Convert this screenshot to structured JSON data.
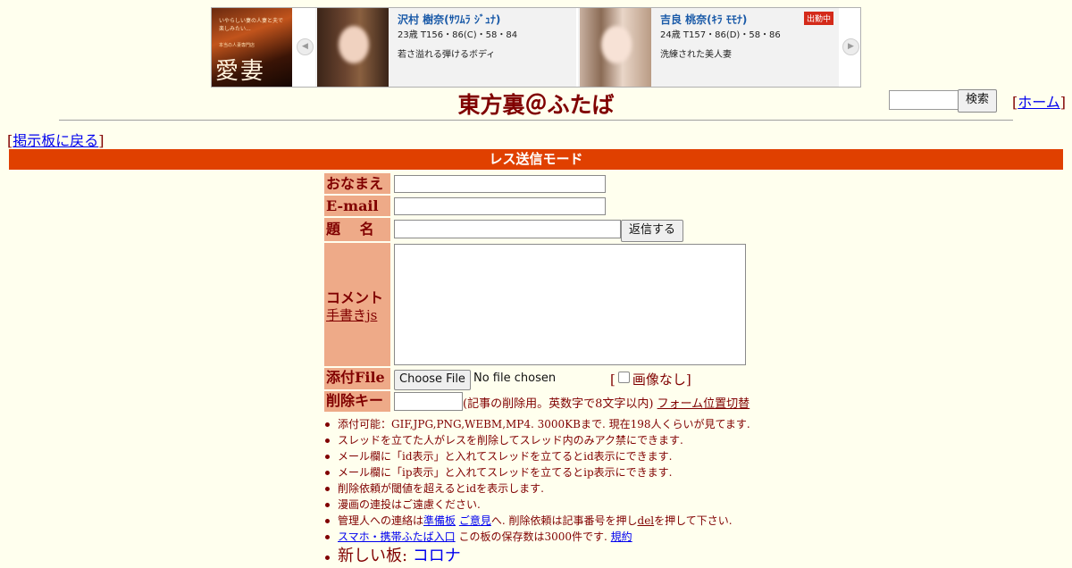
{
  "ad": {
    "logo_tagline": "いやらしい妻の人妻と夫で楽しみたい...",
    "logo_sub": "本当の人妻専門店",
    "logo_big": "愛妻",
    "prev_arrow": "◀",
    "next_arrow": "▶",
    "cards": [
      {
        "name": "沢村 樹奈(ｻﾜﾑﾗ ｼﾞｭﾅ)",
        "stats": "23歳 T156・86(C)・58・84",
        "catch": "若さ溢れる弾けるボディ",
        "badge": ""
      },
      {
        "name": "吉良 桃奈(ｷﾗ ﾓﾓﾅ)",
        "stats": "24歳 T157・86(D)・58・86",
        "catch": "洗練された美人妻",
        "badge": "出勤中"
      }
    ]
  },
  "header": {
    "title": "東方裏＠ふたば",
    "search_button": "検索",
    "home_open": "[",
    "home_link": "ホーム",
    "home_close": "]"
  },
  "nav": {
    "back_open": "[",
    "back_link": "掲示板に戻る",
    "back_close": "]"
  },
  "mode_bar": "レス送信モード",
  "form": {
    "name_label": "おなまえ",
    "email_label": "E-mail",
    "subject_label": "題　 名",
    "submit_button": "返信する",
    "comment_label": "コメント",
    "tegaki_link": "手書きjs",
    "file_label": "添付File",
    "choose_file": "Choose File",
    "no_file": "No file chosen",
    "no_image_label": "画像なし]",
    "no_image_open": "[",
    "delkey_label": "削除キー",
    "delkey_note": "(記事の削除用。英数字で8文字以内)",
    "form_toggle_link": "フォーム位置切替"
  },
  "rules": [
    "添付可能：GIF,JPG,PNG,WEBM,MP4. 3000KBまで. 現在198人くらいが見てます.",
    "スレッドを立てた人がレスを削除してスレッド内のみアク禁にできます.",
    "メール欄に「id表示」と入れてスレッドを立てるとid表示にできます.",
    "メール欄に「ip表示」と入れてスレッドを立てるとip表示にできます.",
    "削除依頼が閾値を超えるとidを表示します.",
    "漫画の連投はご遠慮ください."
  ],
  "contact_rule": {
    "prefix": "管理人への連絡は",
    "junbi_link": "準備板",
    "iken_link": "ご意見",
    "middle": "へ. 削除依頼は記事番号を押し",
    "del_link": "del",
    "suffix": "を押して下さい."
  },
  "mobile_rule": {
    "link": "スマホ・携帯ふたば入口",
    "text": " この板の保存数は3000件です.",
    "kiyaku_link": "規約"
  },
  "new_board": {
    "prefix": "新しい板: ",
    "link": "コロナ"
  }
}
